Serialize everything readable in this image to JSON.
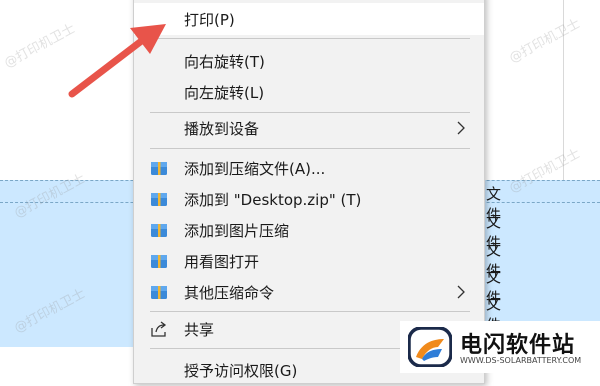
{
  "menu": {
    "items": [
      {
        "label": "打印(P)"
      },
      {
        "label": "向右旋转(T)"
      },
      {
        "label": "向左旋转(L)"
      },
      {
        "label": "播放到设备"
      },
      {
        "label": "添加到压缩文件(A)..."
      },
      {
        "label": "添加到 \"Desktop.zip\" (T)"
      },
      {
        "label": "添加到图片压缩"
      },
      {
        "label": "用看图打开"
      },
      {
        "label": "其他压缩命令"
      },
      {
        "label": "共享"
      },
      {
        "label": "授予访问权限(G)"
      }
    ]
  },
  "background": {
    "row_suffix": "文件"
  },
  "watermark": {
    "text": "@打印机卫士"
  },
  "logo": {
    "title": "电闪软件站",
    "subtitle": "WWW.DS-SOLARBATTERY.COM"
  },
  "colors": {
    "selection": "#cce8ff",
    "arrow": "#e8544a",
    "menu_bg": "#f2f2f2"
  }
}
